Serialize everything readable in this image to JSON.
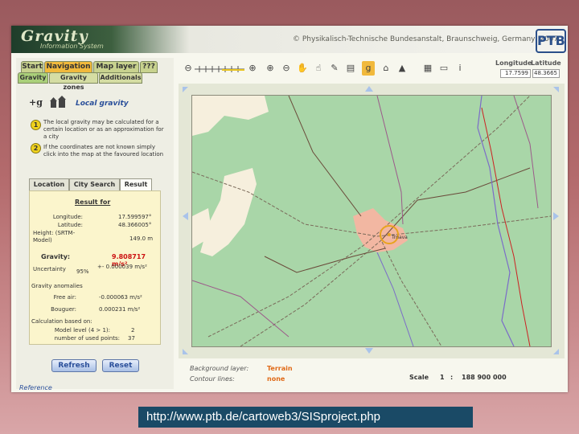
{
  "banner": {
    "logo": "Gravity",
    "logo_sub": "Information System",
    "copyright": "© Physikalisch-Technische Bundesanstalt, Braunschweig, Germany, 2007",
    "ptb_logo": "PTB"
  },
  "nav_tabs": [
    {
      "label": "Start"
    },
    {
      "label": "Navigation",
      "active": true
    },
    {
      "label": "Map layer"
    },
    {
      "label": "???"
    }
  ],
  "sub_tabs": [
    {
      "label": "Gravity",
      "active": true
    },
    {
      "label": "Gravity zones"
    },
    {
      "label": "Additionals"
    }
  ],
  "local_gravity": {
    "icon": "g-icon",
    "title": "Local gravity",
    "step1_num": "1",
    "step1": "The local gravity may be calculated for a certain location or as an approximation for a city",
    "step2_num": "2",
    "step2": "If the coordinates are not known simply click into the map at the favoured location"
  },
  "result_tabs": [
    {
      "label": "Location"
    },
    {
      "label": "City Search"
    },
    {
      "label": "Result",
      "active": true
    }
  ],
  "result": {
    "heading": "Result for",
    "longitude_label": "Longitude:",
    "longitude_value": "17.599597°",
    "latitude_label": "Latitude:",
    "latitude_value": "48.366005°",
    "height_label": "Height: (SRTM-Model)",
    "height_value": "149.0 m",
    "gravity_label": "Gravity:",
    "gravity_value": "9.808717 m/s²",
    "uncertainty_label": "Uncertainty",
    "uncertainty_pct": "95%",
    "uncertainty_value": "+- 0.000039 m/s²",
    "anomalies_heading": "Gravity anomalies",
    "freeair_label": "Free air:",
    "freeair_value": "-0.000063 m/s²",
    "bouguer_label": "Bouguer:",
    "bouguer_value": "0.000231 m/s²",
    "calc_heading": "Calculation based on:",
    "model_level_label": "Model level (4 > 1):",
    "model_level_value": "2",
    "points_label": "number of used points:",
    "points_value": "37"
  },
  "buttons": {
    "refresh": "Refresh",
    "reset": "Reset"
  },
  "reference": "Reference",
  "coords": {
    "longitude_label": "Longitude",
    "latitude_label": "Latitude",
    "longitude_value": "17.7599",
    "latitude_value": "48.3665"
  },
  "map": {
    "marker_label": "Trnava",
    "background_label": "Background layer:",
    "background_value": "Terrain",
    "contour_label": "Contour lines:",
    "contour_value": "none",
    "scale_label": "Scale",
    "scale_prefix": "1",
    "scale_sep": ":",
    "scale_value": "188 900 000"
  },
  "colors": {
    "map_green": "#a9d6a8",
    "map_urban": "#f2b7a2",
    "map_light": "#f6efdd",
    "highlight": "#e8a31e",
    "gravity_red": "#cc1111",
    "legend_orange": "#e06a18"
  },
  "footer_url": "http://www.ptb.de/cartoweb3/SISproject.php"
}
